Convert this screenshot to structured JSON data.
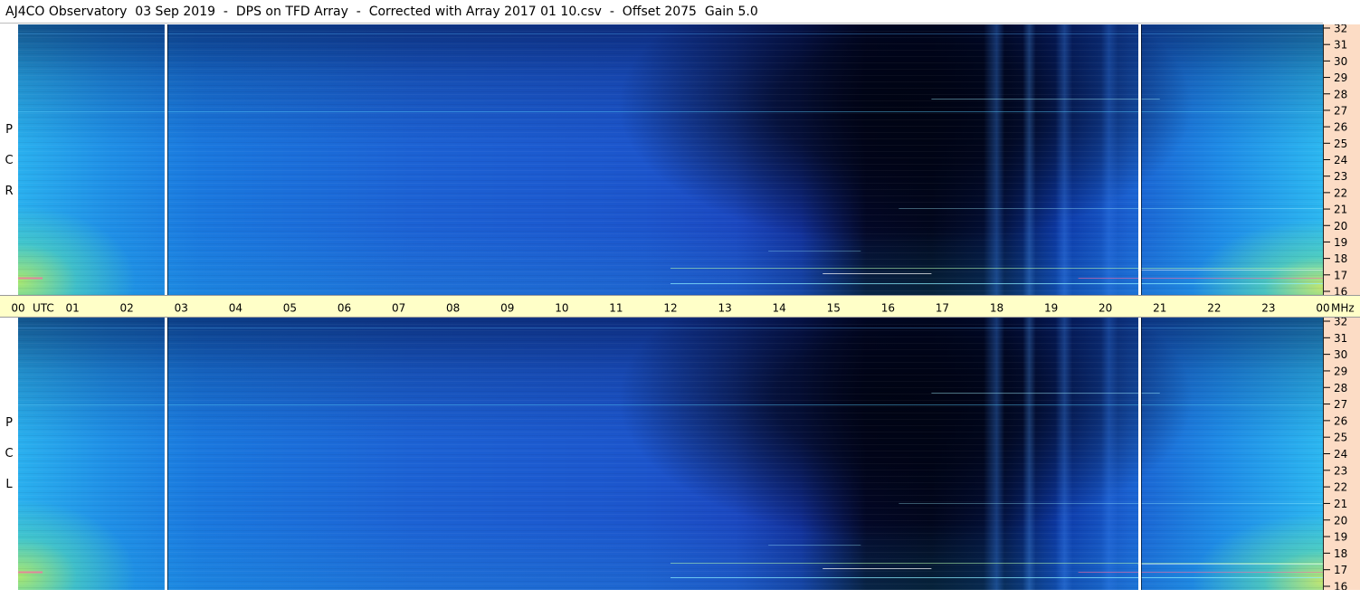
{
  "title": "AJ4CO Observatory  03 Sep 2019  -  DPS on TFD Array  -  Corrected with Array 2017 01 10.csv  -  Offset 2075  Gain 5.0",
  "colors": {
    "background_blue": "#1e5fd2",
    "cyan": "#2ab7f0",
    "dark": "#01071e",
    "time_bar": "#ffffc8",
    "freq_axis": "#fcdcc5"
  },
  "chart_data": {
    "type": "heatmap",
    "title": "AJ4CO Observatory  03 Sep 2019  -  DPS on TFD Array  -  Corrected with Array 2017 01 10.csv  -  Offset 2075  Gain 5.0",
    "x_axis": {
      "unit_label": "UTC",
      "range": [
        0,
        24
      ],
      "tick_labels": [
        "00",
        "01",
        "02",
        "03",
        "04",
        "05",
        "06",
        "07",
        "08",
        "09",
        "10",
        "11",
        "12",
        "13",
        "14",
        "15",
        "16",
        "17",
        "18",
        "19",
        "20",
        "21",
        "22",
        "23",
        "00"
      ]
    },
    "y_axis": {
      "unit_label": "MHz",
      "range": [
        16,
        32
      ],
      "tick_labels": [
        "16",
        "17",
        "18",
        "19",
        "20",
        "21",
        "22",
        "23",
        "24",
        "25",
        "26",
        "27",
        "28",
        "29",
        "30",
        "31",
        "32"
      ]
    },
    "panels": [
      {
        "label_letters": [
          "R",
          "C",
          "P"
        ]
      },
      {
        "label_letters": [
          "L",
          "C",
          "P"
        ]
      }
    ],
    "marker_lines_utc": [
      2.72,
      20.63
    ]
  }
}
